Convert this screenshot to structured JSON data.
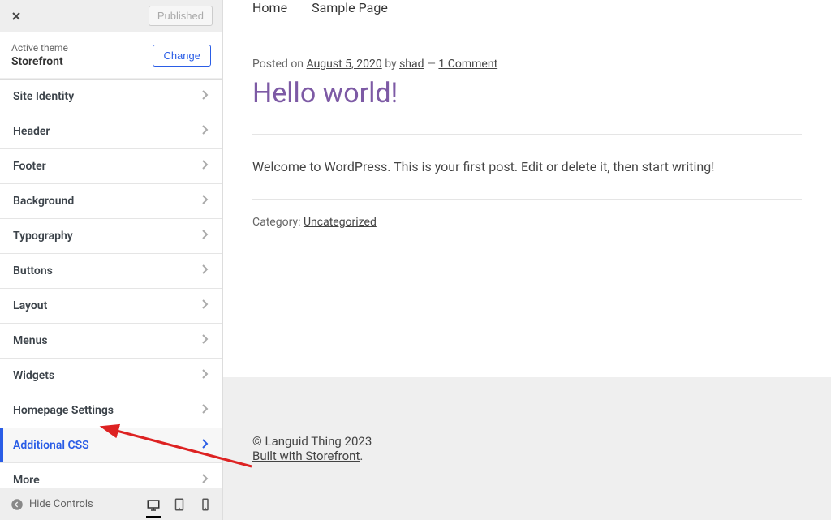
{
  "topbar": {
    "published_label": "Published"
  },
  "theme": {
    "label": "Active theme",
    "name": "Storefront",
    "change_label": "Change"
  },
  "panels": [
    {
      "label": "Site Identity",
      "active": false
    },
    {
      "label": "Header",
      "active": false
    },
    {
      "label": "Footer",
      "active": false
    },
    {
      "label": "Background",
      "active": false
    },
    {
      "label": "Typography",
      "active": false
    },
    {
      "label": "Buttons",
      "active": false
    },
    {
      "label": "Layout",
      "active": false
    },
    {
      "label": "Menus",
      "active": false
    },
    {
      "label": "Widgets",
      "active": false
    },
    {
      "label": "Homepage Settings",
      "active": false
    },
    {
      "label": "Additional CSS",
      "active": true
    },
    {
      "label": "More",
      "active": false
    }
  ],
  "bottom": {
    "hide_controls_label": "Hide Controls"
  },
  "nav": [
    {
      "label": "Home"
    },
    {
      "label": "Sample Page"
    }
  ],
  "post": {
    "posted_on_prefix": "Posted on ",
    "date": "August 5, 2020",
    "by_prefix": " by ",
    "author": "shad",
    "dash": " — ",
    "comments": "1 Comment",
    "title": "Hello world!",
    "body": "Welcome to WordPress. This is your first post. Edit or delete it, then start writing!",
    "category_prefix": "Category: ",
    "category": "Uncategorized"
  },
  "footer": {
    "copyright": "© Languid Thing 2023",
    "built_with": "Built with Storefront",
    "period": "."
  }
}
